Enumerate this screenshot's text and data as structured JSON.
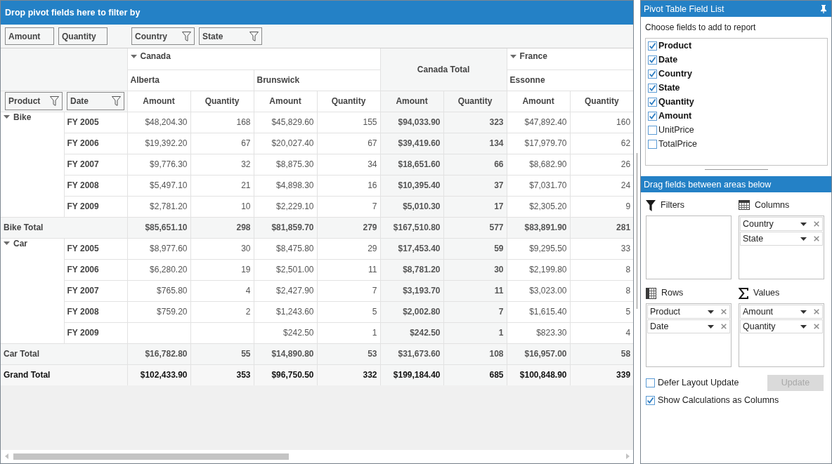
{
  "pivot_grid": {
    "filter_header": "Drop pivot fields here to filter by",
    "header_fields": [
      {
        "label": "Amount",
        "kind": "value"
      },
      {
        "label": "Quantity",
        "kind": "value"
      },
      {
        "label": "Country",
        "kind": "column"
      },
      {
        "label": "State",
        "kind": "column"
      }
    ],
    "row_fields": [
      {
        "label": "Product"
      },
      {
        "label": "Date"
      }
    ],
    "column_groups": [
      {
        "kind": "field",
        "label": "Canada",
        "expanded": true,
        "children": [
          {
            "label": "Alberta"
          },
          {
            "label": "Brunswick"
          }
        ]
      },
      {
        "kind": "total",
        "label": "Canada Total"
      },
      {
        "kind": "field",
        "label": "France",
        "expanded": true,
        "children": [
          {
            "label": "Essonne"
          }
        ]
      }
    ],
    "measure_headers": [
      "Amount",
      "Quantity",
      "Amount",
      "Quantity",
      "Amount",
      "Quantity",
      "Amount",
      "Quantity"
    ],
    "row_groups": [
      {
        "label": "Bike",
        "expanded": true,
        "rows": [
          {
            "label": "FY 2005",
            "cells": [
              "$48,204.30",
              "168",
              "$45,829.60",
              "155",
              "$94,033.90",
              "323",
              "$47,892.40",
              "160"
            ]
          },
          {
            "label": "FY 2006",
            "cells": [
              "$19,392.20",
              "67",
              "$20,027.40",
              "67",
              "$39,419.60",
              "134",
              "$17,979.70",
              "62"
            ]
          },
          {
            "label": "FY 2007",
            "cells": [
              "$9,776.30",
              "32",
              "$8,875.30",
              "34",
              "$18,651.60",
              "66",
              "$8,682.90",
              "26"
            ]
          },
          {
            "label": "FY 2008",
            "cells": [
              "$5,497.10",
              "21",
              "$4,898.30",
              "16",
              "$10,395.40",
              "37",
              "$7,031.70",
              "24"
            ]
          },
          {
            "label": "FY 2009",
            "cells": [
              "$2,781.20",
              "10",
              "$2,229.10",
              "7",
              "$5,010.30",
              "17",
              "$2,305.20",
              "9"
            ]
          }
        ],
        "total": {
          "label": "Bike Total",
          "cells": [
            "$85,651.10",
            "298",
            "$81,859.70",
            "279",
            "$167,510.80",
            "577",
            "$83,891.90",
            "281"
          ]
        }
      },
      {
        "label": "Car",
        "expanded": true,
        "rows": [
          {
            "label": "FY 2005",
            "cells": [
              "$8,977.60",
              "30",
              "$8,475.80",
              "29",
              "$17,453.40",
              "59",
              "$9,295.50",
              "33"
            ]
          },
          {
            "label": "FY 2006",
            "cells": [
              "$6,280.20",
              "19",
              "$2,501.00",
              "11",
              "$8,781.20",
              "30",
              "$2,199.80",
              "8"
            ]
          },
          {
            "label": "FY 2007",
            "cells": [
              "$765.80",
              "4",
              "$2,427.90",
              "7",
              "$3,193.70",
              "11",
              "$3,023.00",
              "8"
            ]
          },
          {
            "label": "FY 2008",
            "cells": [
              "$759.20",
              "2",
              "$1,243.60",
              "5",
              "$2,002.80",
              "7",
              "$1,615.40",
              "5"
            ]
          },
          {
            "label": "FY 2009",
            "cells": [
              null,
              null,
              "$242.50",
              "1",
              "$242.50",
              "1",
              "$823.30",
              "4"
            ]
          }
        ],
        "total": {
          "label": "Car Total",
          "cells": [
            "$16,782.80",
            "55",
            "$14,890.80",
            "53",
            "$31,673.60",
            "108",
            "$16,957.00",
            "58"
          ]
        }
      }
    ],
    "grand_total": {
      "label": "Grand Total",
      "cells": [
        "$102,433.90",
        "353",
        "$96,750.50",
        "332",
        "$199,184.40",
        "685",
        "$100,848.90",
        "339"
      ]
    }
  },
  "field_list": {
    "title": "Pivot Table Field List",
    "prompt": "Choose fields to add to report",
    "items": [
      {
        "label": "Product",
        "checked": true
      },
      {
        "label": "Date",
        "checked": true
      },
      {
        "label": "Country",
        "checked": true
      },
      {
        "label": "State",
        "checked": true
      },
      {
        "label": "Quantity",
        "checked": true
      },
      {
        "label": "Amount",
        "checked": true
      },
      {
        "label": "UnitPrice",
        "checked": false
      },
      {
        "label": "TotalPrice",
        "checked": false
      }
    ],
    "areas_header": "Drag fields between areas below",
    "areas": [
      {
        "kind": "filters",
        "label": "Filters"
      },
      {
        "kind": "columns",
        "label": "Columns",
        "fields": [
          "Country",
          "State"
        ]
      },
      {
        "kind": "rows",
        "label": "Rows",
        "fields": [
          "Product",
          "Date"
        ]
      },
      {
        "kind": "values",
        "label": "Values",
        "fields": [
          "Amount",
          "Quantity"
        ]
      }
    ],
    "options": [
      {
        "label": "Defer Layout Update",
        "checked": false
      },
      {
        "label": "Show Calculations as Columns",
        "checked": true
      }
    ],
    "update_button": {
      "label": "Update",
      "disabled": true
    }
  }
}
